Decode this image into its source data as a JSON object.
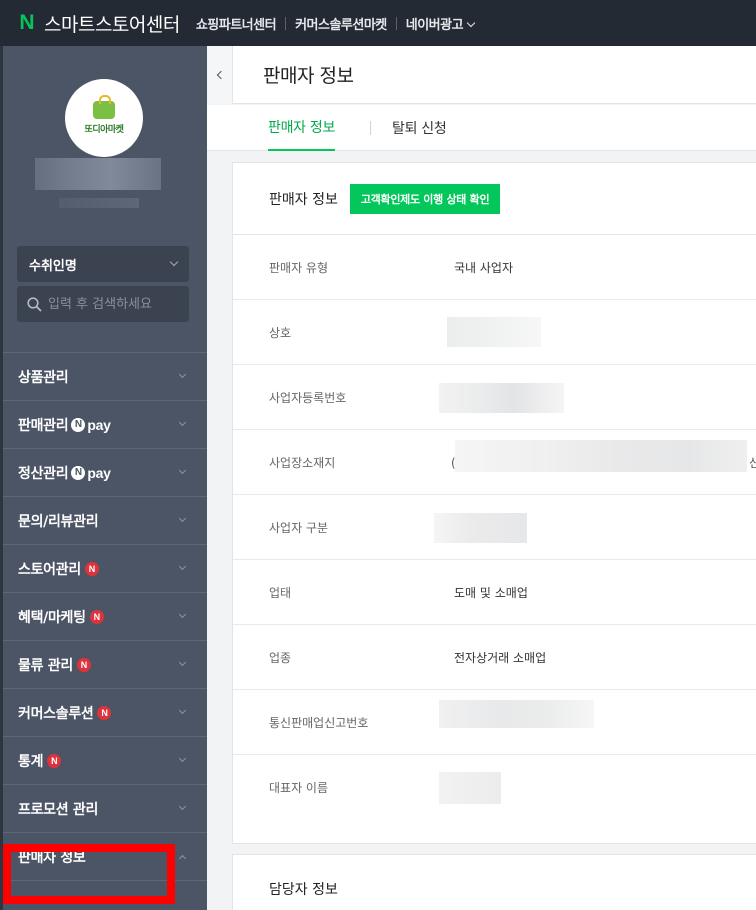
{
  "topbar": {
    "logo_letter": "N",
    "brand": "스마트스토어센터",
    "nav": [
      "쇼핑파트너센터",
      "커머스솔루션마켓",
      "네이버광고"
    ]
  },
  "sidebar": {
    "store_logo_text": "또디아마켓",
    "select_value": "수취인명",
    "search_placeholder": "입력 후 검색하세요",
    "pay_text": "pay",
    "n_mark": "N",
    "menu": [
      {
        "label": "상품관리"
      },
      {
        "label": "판매관리"
      },
      {
        "label": "정산관리"
      },
      {
        "label": "문의/리뷰관리"
      },
      {
        "label": "스토어관리"
      },
      {
        "label": "혜택/마케팅"
      },
      {
        "label": "물류 관리"
      },
      {
        "label": "커머스솔루션"
      },
      {
        "label": "통계"
      },
      {
        "label": "프로모션 관리"
      },
      {
        "label": "판매자 정보"
      }
    ]
  },
  "main": {
    "page_title": "판매자 정보",
    "tabs": [
      {
        "label": "판매자 정보"
      },
      {
        "label": "탈퇴 신청"
      }
    ],
    "section_title": "판매자 정보",
    "status_button": "고객확인제도 이행 상태 확인",
    "rows": [
      {
        "label": "판매자 유형",
        "value": "국내 사업자"
      },
      {
        "label": "상호",
        "value": ""
      },
      {
        "label": "사업자등록번호",
        "value": ""
      },
      {
        "label": "사업장소재지",
        "value": ""
      },
      {
        "label": "사업자 구분",
        "value": ""
      },
      {
        "label": "업태",
        "value": "도매 및 소매업"
      },
      {
        "label": "업종",
        "value": "전자상거래 소매업"
      },
      {
        "label": "통신판매업신고번호",
        "value": ""
      },
      {
        "label": "대표자 이름",
        "value": ""
      }
    ],
    "address_clip_start": "(",
    "address_clip_end": "신",
    "manager_section_title": "담당자 정보"
  },
  "colors": {
    "naver_green": "#03c75a",
    "topbar_bg": "#242a33",
    "sidebar_bg": "#4c5565",
    "highlight_red": "#ff0000",
    "badge_red": "#e0323c"
  }
}
